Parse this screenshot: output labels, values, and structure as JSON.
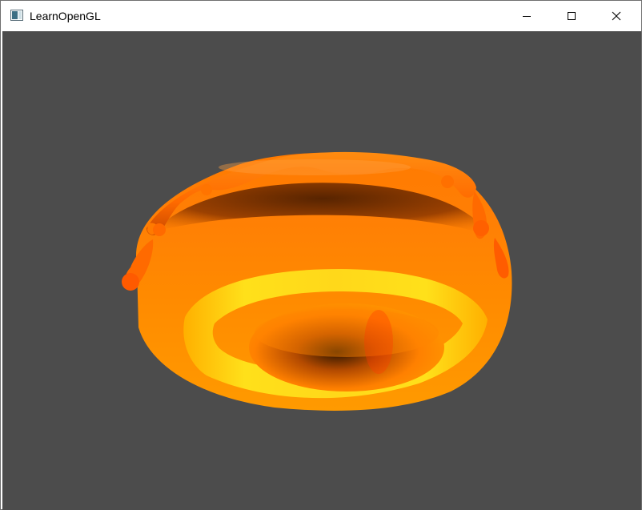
{
  "window": {
    "title": "LearnOpenGL",
    "icon": "app-window-icon",
    "controls": {
      "minimize": "minimize-icon",
      "maximize": "maximize-icon",
      "close": "close-icon"
    }
  },
  "scene": {
    "clear_color": "#4c4c4c",
    "object": "donut-model",
    "colors": {
      "primary": "#ff7a00",
      "highlight": "#ffe01a",
      "shadow": "#3a1a00"
    }
  }
}
